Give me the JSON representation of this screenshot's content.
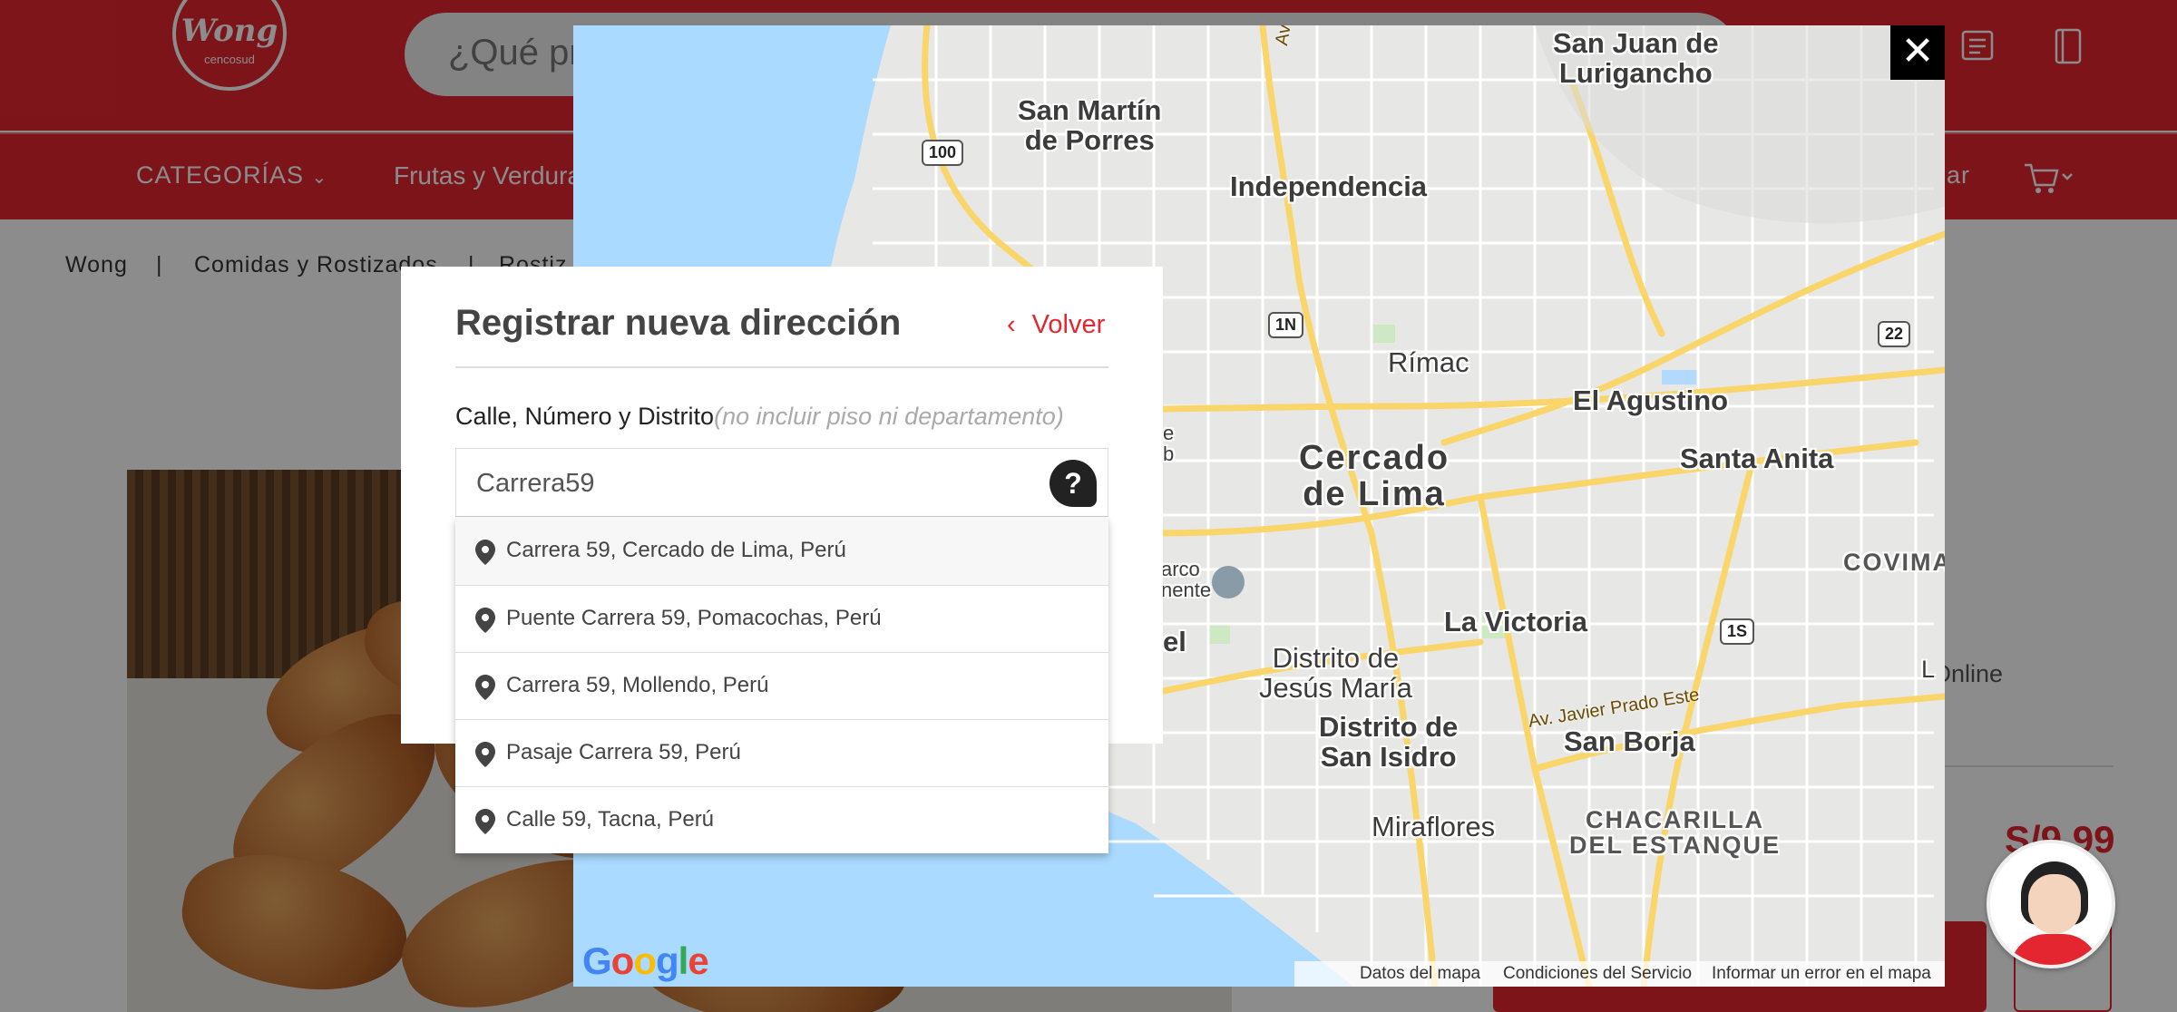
{
  "header": {
    "logo_text": "Wong",
    "logo_sub": "cencosud",
    "search_placeholder": "¿Qué pr",
    "icons": [
      "orders-icon",
      "book-icon"
    ]
  },
  "nav": {
    "categories_label": "CATEGORÍAS",
    "item_1": "Frutas y Verdura",
    "item_partial": "ar"
  },
  "breadcrumb": {
    "root": "Wong",
    "sep": "|",
    "level_1": "Comidas y Rostizados",
    "level_2": "Rostiz"
  },
  "product": {
    "online_text": "Online",
    "price": "S/9.99"
  },
  "map": {
    "labels": {
      "san_juan": "San Juan de\nLurigancho",
      "san_martin": "San Martín\nde Porres",
      "independencia": "Independencia",
      "rimac": "Rímac",
      "el_agustino": "El Agustino",
      "santa_anita": "Santa Anita",
      "cercado": "Cercado\nde Lima",
      "la_victoria": "La Victoria",
      "covima": "COVIMA",
      "jesus_maria": "Distrito de\nJesús María",
      "san_isidro": "Distrito de\nSan Isidro",
      "san_borja": "San Borja",
      "miraflores": "Miraflores",
      "chacarilla": "CHACARILLA\nDEL ESTANQUE",
      "parque_partial": "arco\nnente",
      "el_partial": "el",
      "e_partial": "e\nb",
      "l_partial": "L"
    },
    "roads": {
      "r100": "100",
      "r1n": "1N",
      "r22": "22",
      "r1s": "1S",
      "av_tupac": "Av. Tupac",
      "av_javier_prado": "Av. Javier Prado Este"
    },
    "google": "Google",
    "footer": {
      "datos": "Datos del mapa",
      "condiciones": "Condiciones del Servicio",
      "informar": "Informar un error en el mapa"
    },
    "close_symbol": "✕"
  },
  "dialog": {
    "title": "Registrar nueva dirección",
    "back_label": "Volver",
    "back_chevron": "‹",
    "field_label": "Calle, Número y Distrito",
    "field_hint": "(no incluir piso ni departamento)",
    "field_value": "Carrera59",
    "help_symbol": "?"
  },
  "suggestions": [
    "Carrera 59, Cercado de Lima, Perú",
    "Puente Carrera 59, Pomacochas, Perú",
    "Carrera 59, Mollendo, Perú",
    "Pasaje Carrera 59, Perú",
    "Calle 59, Tacna, Perú"
  ],
  "colors": {
    "brand_red": "#e3262f",
    "water": "#aadaff",
    "road_major": "#f9d56a"
  }
}
